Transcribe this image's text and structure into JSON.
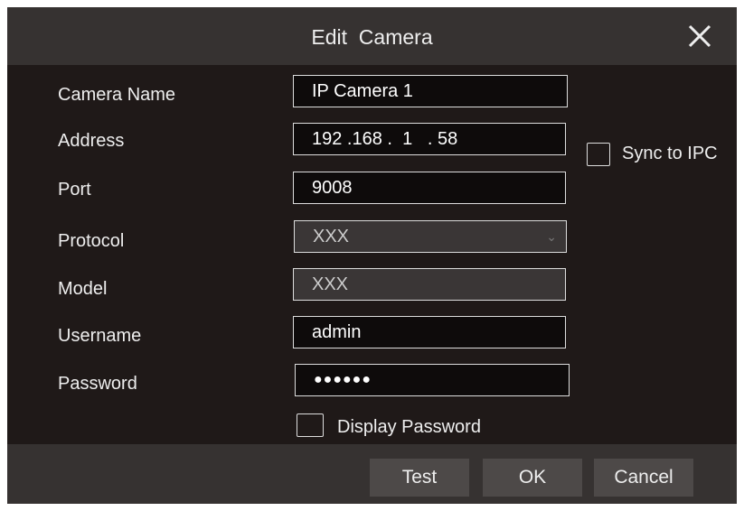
{
  "title": "Edit  Camera",
  "labels": {
    "camera_name": "Camera Name",
    "address": "Address",
    "port": "Port",
    "protocol": "Protocol",
    "model": "Model",
    "username": "Username",
    "password": "Password"
  },
  "values": {
    "camera_name": "IP Camera 1",
    "address": "192 .168 .  1   . 58",
    "port": "9008",
    "protocol": "XXX",
    "model": "XXX",
    "username": "admin",
    "password": "●●●●●●"
  },
  "sync_to_ipc": {
    "label": "Sync to IPC",
    "checked": false
  },
  "display_password": {
    "label": "Display Password",
    "checked": false
  },
  "buttons": {
    "test": "Test",
    "ok": "OK",
    "cancel": "Cancel"
  }
}
